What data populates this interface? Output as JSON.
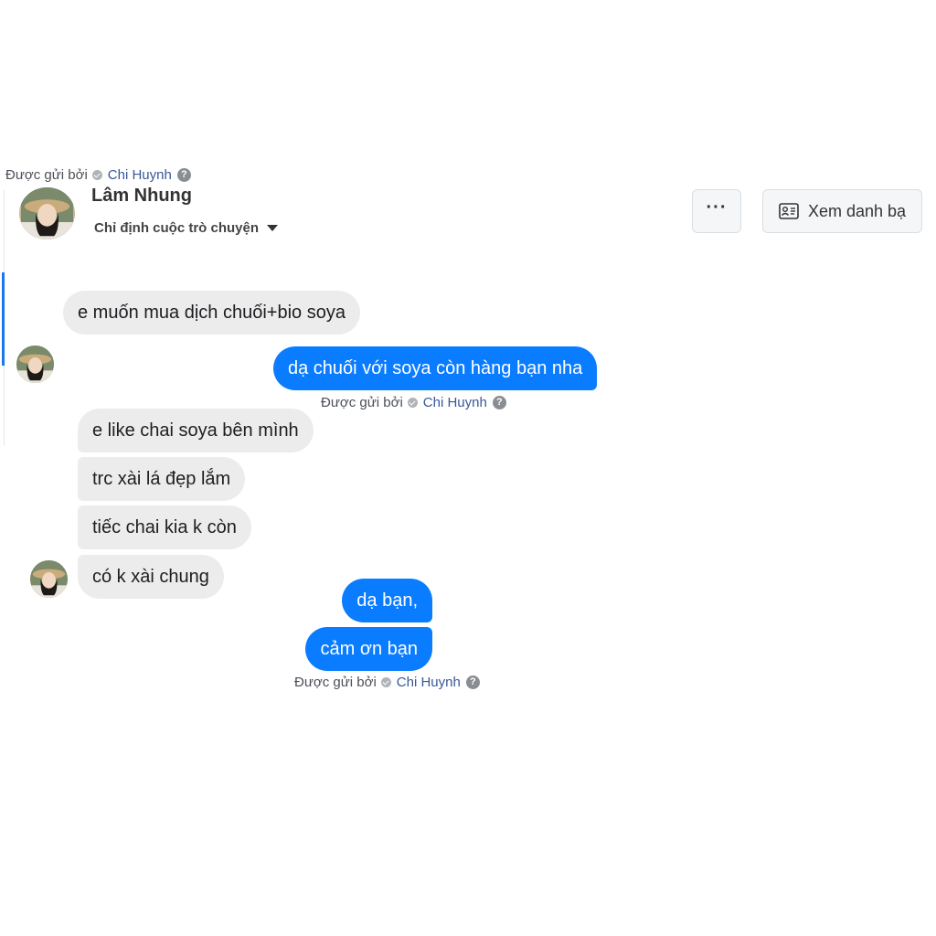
{
  "header": {
    "sent_by_label": "Được gửi bởi",
    "sent_by_name": "Chi Huynh",
    "contact_name": "Lâm Nhung",
    "assign_label": "Chỉ định cuộc trò chuyện",
    "more_label": "···",
    "contacts_button_label": "Xem danh bạ"
  },
  "messages": {
    "m1": "e muốn mua dịch chuối+bio soya",
    "m2": "dạ chuối với soya còn hàng bạn nha",
    "m3": "e like chai soya bên mình",
    "m4": "trc xài lá đẹp lắm",
    "m5": "tiếc chai kia k còn",
    "m6": "có k xài chung",
    "m7": "dạ bạn,",
    "m8": "cảm ơn bạn"
  },
  "attribution": {
    "label": "Được gửi bởi",
    "name": "Chi Huynh",
    "help": "?"
  },
  "colors": {
    "outgoing_bubble": "#0a7cff",
    "incoming_bubble": "#ececec",
    "link": "#385898"
  },
  "icons": {
    "verified": "verified-check-icon",
    "help": "help-icon",
    "caret": "caret-down-icon",
    "contacts": "contact-card-icon"
  }
}
